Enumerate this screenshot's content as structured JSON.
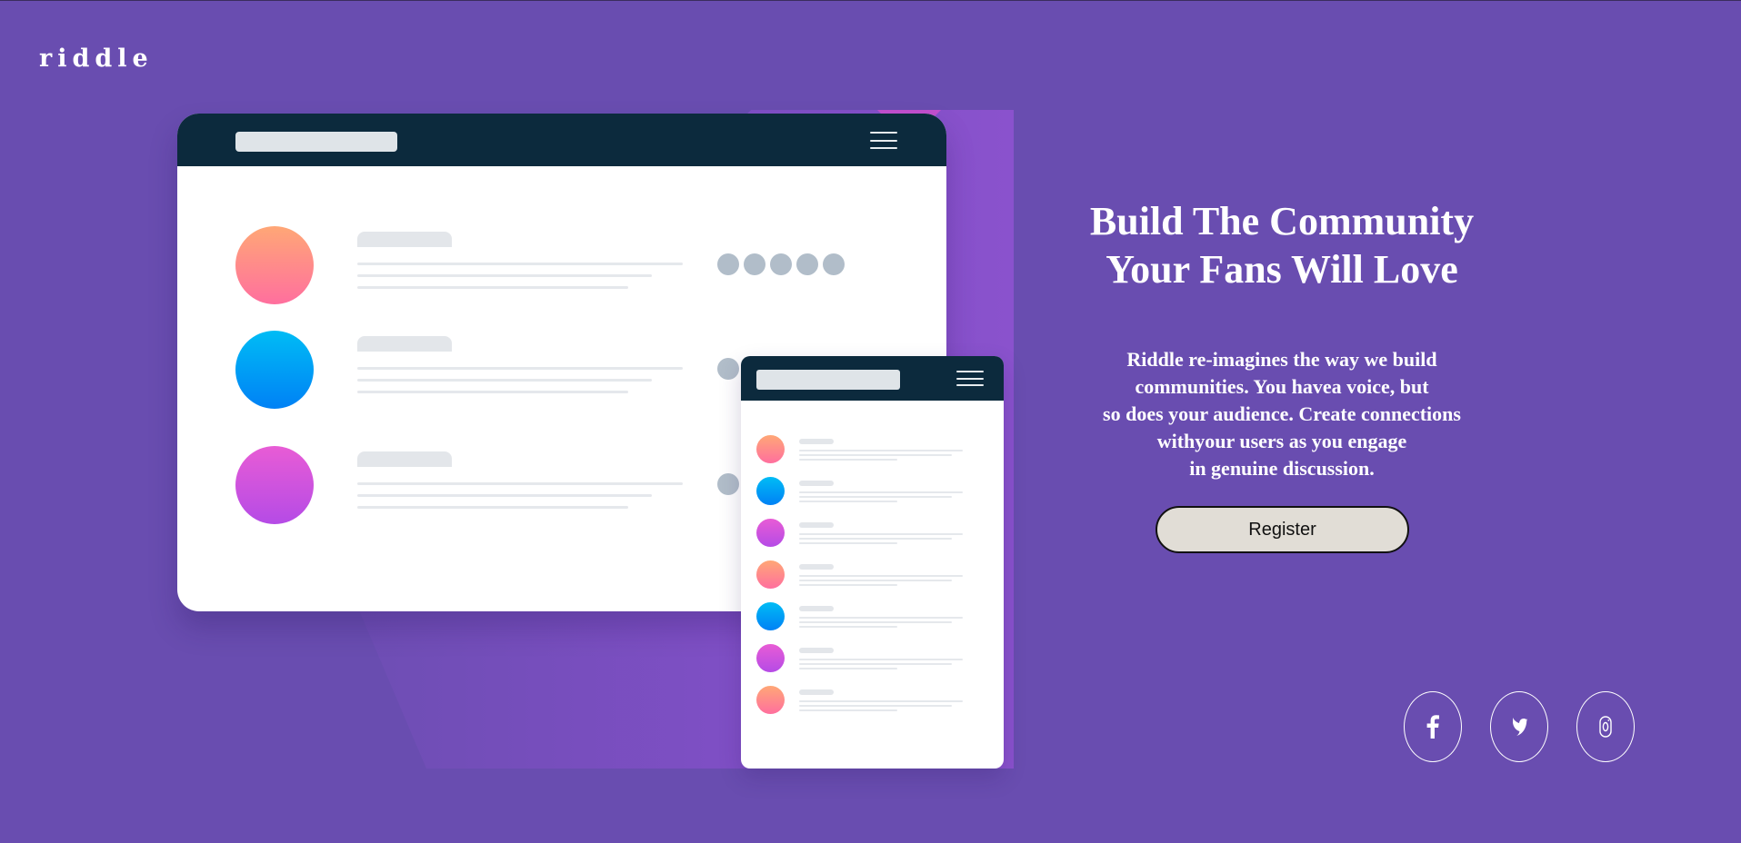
{
  "brand": {
    "logo": "riddle"
  },
  "hero": {
    "title": "Build The Community\nYour Fans Will Love",
    "description": "Riddle re-imagines the way we build\ncommunities. You havea voice, but\nso does your audience. Create connections\nwithyour users as you engage\nin genuine discussion.",
    "register_label": "Register"
  },
  "social": [
    {
      "icon": "facebook-icon"
    },
    {
      "icon": "twitter-icon"
    },
    {
      "icon": "instagram-icon"
    }
  ],
  "colors": {
    "background": "#694db0",
    "window_bar": "#0c2a3d",
    "button": "#e1ddd6",
    "text": "#ffffff"
  }
}
